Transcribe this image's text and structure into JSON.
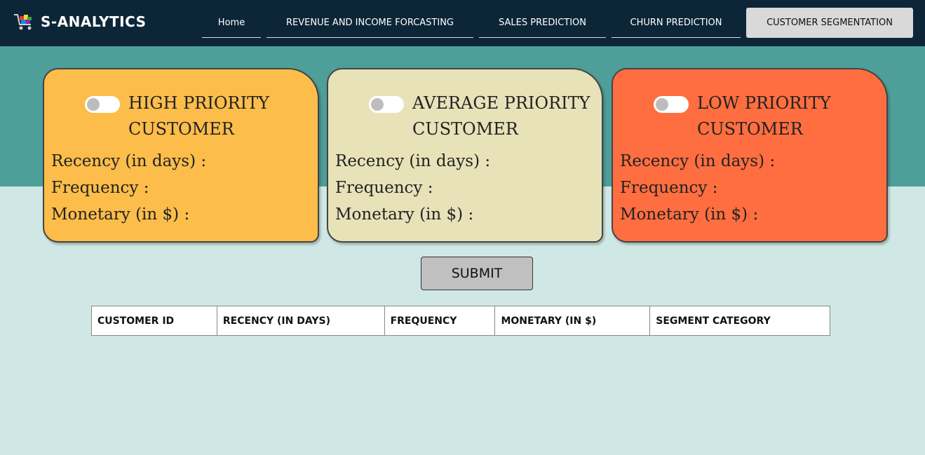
{
  "brand": {
    "name": "S-ANALYTICS"
  },
  "nav": {
    "items": [
      {
        "label": "Home"
      },
      {
        "label": "REVENUE AND INCOME FORCASTING"
      },
      {
        "label": "SALES PREDICTION"
      },
      {
        "label": "CHURN PREDICTION"
      },
      {
        "label": "CUSTOMER SEGMENTATION"
      }
    ],
    "active": "CUSTOMER SEGMENTATION"
  },
  "cards": [
    {
      "title_line1": "HIGH PRIORITY",
      "title_line2": "CUSTOMER",
      "recency": "Recency (in days) :",
      "frequency": "Frequency :",
      "monetary": "Monetary (in $) :",
      "color": "#fdbd4a",
      "toggle_on": false
    },
    {
      "title_line1": "AVERAGE PRIORITY",
      "title_line2": "CUSTOMER",
      "recency": "Recency (in days) :",
      "frequency": "Frequency :",
      "monetary": "Monetary (in $) :",
      "color": "#e8e2b9",
      "toggle_on": false
    },
    {
      "title_line1": "LOW PRIORITY",
      "title_line2": "CUSTOMER",
      "recency": "Recency (in days) :",
      "frequency": "Frequency :",
      "monetary": "Monetary (in $) :",
      "color": "#fe6e40",
      "toggle_on": false
    }
  ],
  "submit": {
    "label": "SUBMIT"
  },
  "table": {
    "columns": [
      "CUSTOMER ID",
      "RECENCY (IN DAYS)",
      "FREQUENCY",
      "MONETARY (IN $)",
      "SEGMENT CATEGORY"
    ]
  },
  "colors": {
    "navbar": "#0c2638",
    "teal": "#4e9e99",
    "background": "#cfe8e5"
  }
}
